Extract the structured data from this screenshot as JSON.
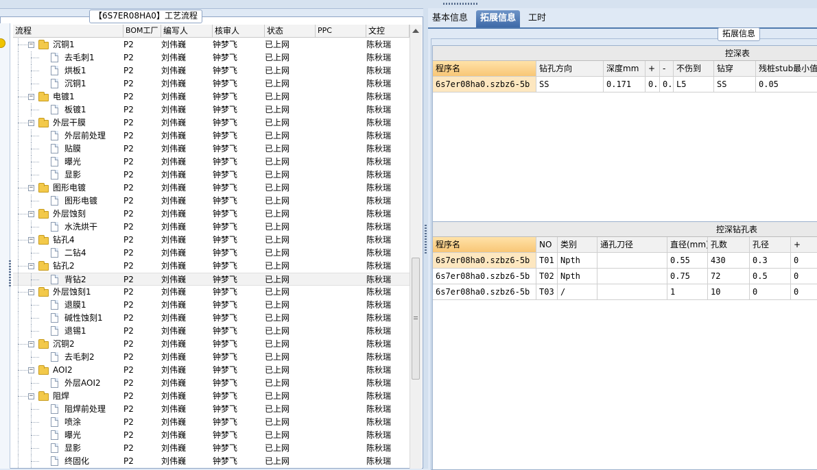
{
  "left_panel": {
    "title": "【6S7ER08HA0】工艺流程",
    "columns": [
      "流程",
      "BOM工厂",
      "编写人",
      "核审人",
      "状态",
      "PPC",
      "文控"
    ],
    "rows": [
      {
        "name": "沉铜1",
        "level": 1,
        "type": "folder",
        "bom": "P2",
        "writer": "刘伟巍",
        "reviewer": "钟梦飞",
        "status": "已上网",
        "ppc": "",
        "ctrl": "陈秋瑞"
      },
      {
        "name": "去毛刺1",
        "level": 2,
        "type": "doc",
        "bom": "P2",
        "writer": "刘伟巍",
        "reviewer": "钟梦飞",
        "status": "已上网",
        "ppc": "",
        "ctrl": "陈秋瑞"
      },
      {
        "name": "烘板1",
        "level": 2,
        "type": "doc",
        "bom": "P2",
        "writer": "刘伟巍",
        "reviewer": "钟梦飞",
        "status": "已上网",
        "ppc": "",
        "ctrl": "陈秋瑞"
      },
      {
        "name": "沉铜1",
        "level": 2,
        "type": "doc",
        "bom": "P2",
        "writer": "刘伟巍",
        "reviewer": "钟梦飞",
        "status": "已上网",
        "ppc": "",
        "ctrl": "陈秋瑞"
      },
      {
        "name": "电镀1",
        "level": 1,
        "type": "folder",
        "bom": "P2",
        "writer": "刘伟巍",
        "reviewer": "钟梦飞",
        "status": "已上网",
        "ppc": "",
        "ctrl": "陈秋瑞"
      },
      {
        "name": "板镀1",
        "level": 2,
        "type": "doc",
        "bom": "P2",
        "writer": "刘伟巍",
        "reviewer": "钟梦飞",
        "status": "已上网",
        "ppc": "",
        "ctrl": "陈秋瑞"
      },
      {
        "name": "外层干膜",
        "level": 1,
        "type": "folder",
        "bom": "P2",
        "writer": "刘伟巍",
        "reviewer": "钟梦飞",
        "status": "已上网",
        "ppc": "",
        "ctrl": "陈秋瑞"
      },
      {
        "name": "外层前处理",
        "level": 2,
        "type": "doc",
        "bom": "P2",
        "writer": "刘伟巍",
        "reviewer": "钟梦飞",
        "status": "已上网",
        "ppc": "",
        "ctrl": "陈秋瑞"
      },
      {
        "name": "贴膜",
        "level": 2,
        "type": "doc",
        "bom": "P2",
        "writer": "刘伟巍",
        "reviewer": "钟梦飞",
        "status": "已上网",
        "ppc": "",
        "ctrl": "陈秋瑞"
      },
      {
        "name": "曝光",
        "level": 2,
        "type": "doc",
        "bom": "P2",
        "writer": "刘伟巍",
        "reviewer": "钟梦飞",
        "status": "已上网",
        "ppc": "",
        "ctrl": "陈秋瑞"
      },
      {
        "name": "显影",
        "level": 2,
        "type": "doc",
        "bom": "P2",
        "writer": "刘伟巍",
        "reviewer": "钟梦飞",
        "status": "已上网",
        "ppc": "",
        "ctrl": "陈秋瑞"
      },
      {
        "name": "图形电镀",
        "level": 1,
        "type": "folder",
        "bom": "P2",
        "writer": "刘伟巍",
        "reviewer": "钟梦飞",
        "status": "已上网",
        "ppc": "",
        "ctrl": "陈秋瑞"
      },
      {
        "name": "图形电镀",
        "level": 2,
        "type": "doc",
        "bom": "P2",
        "writer": "刘伟巍",
        "reviewer": "钟梦飞",
        "status": "已上网",
        "ppc": "",
        "ctrl": "陈秋瑞"
      },
      {
        "name": "外层蚀刻",
        "level": 1,
        "type": "folder",
        "bom": "P2",
        "writer": "刘伟巍",
        "reviewer": "钟梦飞",
        "status": "已上网",
        "ppc": "",
        "ctrl": "陈秋瑞"
      },
      {
        "name": "水洗烘干",
        "level": 2,
        "type": "doc",
        "bom": "P2",
        "writer": "刘伟巍",
        "reviewer": "钟梦飞",
        "status": "已上网",
        "ppc": "",
        "ctrl": "陈秋瑞"
      },
      {
        "name": "钻孔4",
        "level": 1,
        "type": "folder",
        "bom": "P2",
        "writer": "刘伟巍",
        "reviewer": "钟梦飞",
        "status": "已上网",
        "ppc": "",
        "ctrl": "陈秋瑞"
      },
      {
        "name": "二钻4",
        "level": 2,
        "type": "doc",
        "bom": "P2",
        "writer": "刘伟巍",
        "reviewer": "钟梦飞",
        "status": "已上网",
        "ppc": "",
        "ctrl": "陈秋瑞"
      },
      {
        "name": "钻孔2",
        "level": 1,
        "type": "folder",
        "bom": "P2",
        "writer": "刘伟巍",
        "reviewer": "钟梦飞",
        "status": "已上网",
        "ppc": "",
        "ctrl": "陈秋瑞"
      },
      {
        "name": "背钻2",
        "level": 2,
        "type": "doc",
        "bom": "P2",
        "writer": "刘伟巍",
        "reviewer": "钟梦飞",
        "status": "已上网",
        "ppc": "",
        "ctrl": "陈秋瑞",
        "selected": true
      },
      {
        "name": "外层蚀刻1",
        "level": 1,
        "type": "folder",
        "bom": "P2",
        "writer": "刘伟巍",
        "reviewer": "钟梦飞",
        "status": "已上网",
        "ppc": "",
        "ctrl": "陈秋瑞"
      },
      {
        "name": "退膜1",
        "level": 2,
        "type": "doc",
        "bom": "P2",
        "writer": "刘伟巍",
        "reviewer": "钟梦飞",
        "status": "已上网",
        "ppc": "",
        "ctrl": "陈秋瑞"
      },
      {
        "name": "碱性蚀刻1",
        "level": 2,
        "type": "doc",
        "bom": "P2",
        "writer": "刘伟巍",
        "reviewer": "钟梦飞",
        "status": "已上网",
        "ppc": "",
        "ctrl": "陈秋瑞"
      },
      {
        "name": "退锡1",
        "level": 2,
        "type": "doc",
        "bom": "P2",
        "writer": "刘伟巍",
        "reviewer": "钟梦飞",
        "status": "已上网",
        "ppc": "",
        "ctrl": "陈秋瑞"
      },
      {
        "name": "沉铜2",
        "level": 1,
        "type": "folder",
        "bom": "P2",
        "writer": "刘伟巍",
        "reviewer": "钟梦飞",
        "status": "已上网",
        "ppc": "",
        "ctrl": "陈秋瑞"
      },
      {
        "name": "去毛刺2",
        "level": 2,
        "type": "doc",
        "bom": "P2",
        "writer": "刘伟巍",
        "reviewer": "钟梦飞",
        "status": "已上网",
        "ppc": "",
        "ctrl": "陈秋瑞"
      },
      {
        "name": "AOI2",
        "level": 1,
        "type": "folder",
        "bom": "P2",
        "writer": "刘伟巍",
        "reviewer": "钟梦飞",
        "status": "已上网",
        "ppc": "",
        "ctrl": "陈秋瑞"
      },
      {
        "name": "外层AOI2",
        "level": 2,
        "type": "doc",
        "bom": "P2",
        "writer": "刘伟巍",
        "reviewer": "钟梦飞",
        "status": "已上网",
        "ppc": "",
        "ctrl": "陈秋瑞"
      },
      {
        "name": "阻焊",
        "level": 1,
        "type": "folder",
        "bom": "P2",
        "writer": "刘伟巍",
        "reviewer": "钟梦飞",
        "status": "已上网",
        "ppc": "",
        "ctrl": "陈秋瑞"
      },
      {
        "name": "阻焊前处理",
        "level": 2,
        "type": "doc",
        "bom": "P2",
        "writer": "刘伟巍",
        "reviewer": "钟梦飞",
        "status": "已上网",
        "ppc": "",
        "ctrl": "陈秋瑞"
      },
      {
        "name": "喷涂",
        "level": 2,
        "type": "doc",
        "bom": "P2",
        "writer": "刘伟巍",
        "reviewer": "钟梦飞",
        "status": "已上网",
        "ppc": "",
        "ctrl": "陈秋瑞"
      },
      {
        "name": "曝光",
        "level": 2,
        "type": "doc",
        "bom": "P2",
        "writer": "刘伟巍",
        "reviewer": "钟梦飞",
        "status": "已上网",
        "ppc": "",
        "ctrl": "陈秋瑞"
      },
      {
        "name": "显影",
        "level": 2,
        "type": "doc",
        "bom": "P2",
        "writer": "刘伟巍",
        "reviewer": "钟梦飞",
        "status": "已上网",
        "ppc": "",
        "ctrl": "陈秋瑞"
      },
      {
        "name": "终固化",
        "level": 2,
        "type": "doc",
        "bom": "P2",
        "writer": "刘伟巍",
        "reviewer": "钟梦飞",
        "status": "已上网",
        "ppc": "",
        "ctrl": "陈秋瑞"
      }
    ]
  },
  "right_panel": {
    "tabs": [
      {
        "label": "基本信息",
        "active": false
      },
      {
        "label": "拓展信息",
        "active": true
      },
      {
        "label": "工时",
        "active": false
      }
    ],
    "ext_label": "拓展信息",
    "depth_table": {
      "title": "控深表",
      "columns": [
        "程序名",
        "钻孔方向",
        "深度mm",
        "+",
        "-",
        "不伤到",
        "钻穿",
        "残桩stub最小值"
      ],
      "rows": [
        [
          "6s7er08ha0.szbz6-5b",
          "SS",
          "0.171",
          "0..",
          "0..",
          "L5",
          "SS",
          "0.05"
        ]
      ]
    },
    "hole_table": {
      "title": "控深钻孔表",
      "columns": [
        "程序名",
        "NO",
        "类别",
        "通孔刀径",
        "直径(mm)",
        "孔数",
        "孔径",
        "+"
      ],
      "rows": [
        [
          "6s7er08ha0.szbz6-5b",
          "T01",
          "Npth",
          "",
          "0.55",
          "430",
          "0.3",
          "0"
        ],
        [
          "6s7er08ha0.szbz6-5b",
          "T02",
          "Npth",
          "",
          "0.75",
          "72",
          "0.5",
          "0"
        ],
        [
          "6s7er08ha0.szbz6-5b",
          "T03",
          "/",
          "",
          "1",
          "10",
          "0",
          "0"
        ]
      ]
    }
  }
}
